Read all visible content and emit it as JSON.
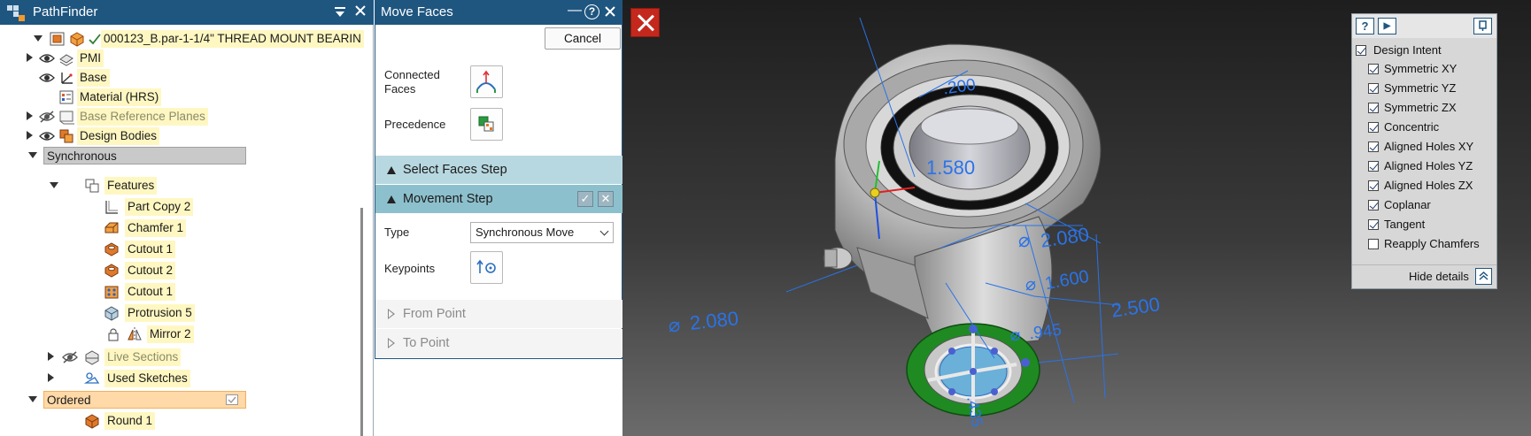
{
  "pathfinder": {
    "title": "PathFinder",
    "root": "000123_B.par-1-1/4\" THREAD MOUNT BEARIN",
    "items": [
      {
        "label": "PMI",
        "icon": "pmi-icon"
      },
      {
        "label": "Base",
        "icon": "coordinate-system-icon"
      },
      {
        "label": "Material (HRS)",
        "icon": "material-table-icon"
      },
      {
        "label": "Base Reference Planes",
        "icon": "reference-planes-icon"
      },
      {
        "label": "Design Bodies",
        "icon": "design-bodies-icon"
      },
      {
        "label": "Synchronous"
      },
      {
        "label": "Features",
        "icon": "features-icon"
      },
      {
        "label": "Part Copy 2",
        "icon": "part-copy-icon"
      },
      {
        "label": "Chamfer 1",
        "icon": "chamfer-icon"
      },
      {
        "label": "Cutout 1",
        "icon": "cutout-icon"
      },
      {
        "label": "Cutout 2",
        "icon": "cutout-icon"
      },
      {
        "label": "Cutout 1",
        "icon": "cutout-pattern-icon"
      },
      {
        "label": "Protrusion 5",
        "icon": "protrusion-icon"
      },
      {
        "label": "Mirror 2",
        "icon": "mirror-icon"
      },
      {
        "label": "Live Sections",
        "icon": "live-sections-icon"
      },
      {
        "label": "Used Sketches",
        "icon": "used-sketches-icon"
      },
      {
        "label": "Ordered"
      },
      {
        "label": "Round 1",
        "icon": "round-icon"
      }
    ]
  },
  "move_faces": {
    "title": "Move Faces",
    "cancel_label": "Cancel",
    "connected_faces_label": "Connected\nFaces",
    "precedence_label": "Precedence",
    "select_faces_step": "Select Faces Step",
    "movement_step": "Movement Step",
    "type_label": "Type",
    "type_value": "Synchronous Move",
    "keypoints_label": "Keypoints",
    "from_point": "From Point",
    "to_point": "To Point"
  },
  "viewport": {
    "dimensions": [
      ".200",
      "1.580",
      "2.080",
      "1.600",
      "2.500",
      ".945",
      "2.080",
      ".435"
    ]
  },
  "design_intent": {
    "toolbar": [
      "?",
      "▶",
      "pin"
    ],
    "items": [
      {
        "label": "Design Intent",
        "checked": true
      },
      {
        "label": "Symmetric XY",
        "checked": true
      },
      {
        "label": "Symmetric YZ",
        "checked": true
      },
      {
        "label": "Symmetric ZX",
        "checked": true
      },
      {
        "label": "Concentric",
        "checked": true
      },
      {
        "label": "Aligned Holes XY",
        "checked": true
      },
      {
        "label": "Aligned Holes YZ",
        "checked": true
      },
      {
        "label": "Aligned Holes ZX",
        "checked": true
      },
      {
        "label": "Coplanar",
        "checked": true
      },
      {
        "label": "Tangent",
        "checked": true
      },
      {
        "label": "Reapply Chamfers",
        "checked": false
      }
    ],
    "hide_details": "Hide details"
  },
  "colors": {
    "titlebar": "#1f5680",
    "highlight": "#fff7c2",
    "dimension": "#2a73e8",
    "close_red": "#c4281c"
  }
}
